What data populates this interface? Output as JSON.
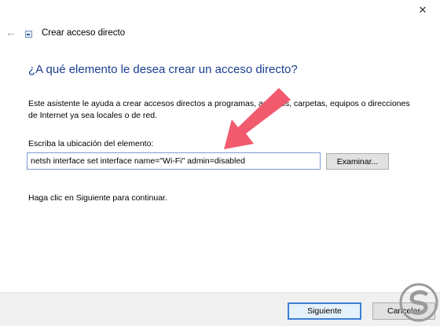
{
  "window": {
    "title": "Crear acceso directo",
    "close_glyph": "✕",
    "back_glyph": "←"
  },
  "heading": "¿A qué elemento le desea crear un acceso directo?",
  "description": "Este asistente le ayuda a crear accesos directos a programas, archivos, carpetas, equipos o direcciones de Internet ya sea locales o de red.",
  "location": {
    "label": "Escriba la ubicación del elemento:",
    "value": "netsh interface set interface name=\"Wi-Fi\" admin=disabled"
  },
  "browse_label": "Examinar...",
  "hint": "Haga clic en Siguiente para continuar.",
  "footer": {
    "next_label": "Siguiente",
    "cancel_label": "Cancelar"
  },
  "annotation": {
    "arrow_color": "#f25a6e"
  },
  "watermark": {
    "color": "#9b9b9b"
  },
  "icons": [
    "close-icon",
    "back-arrow-icon",
    "shortcut-wizard-icon",
    "annotation-arrow",
    "watermark-logo"
  ]
}
